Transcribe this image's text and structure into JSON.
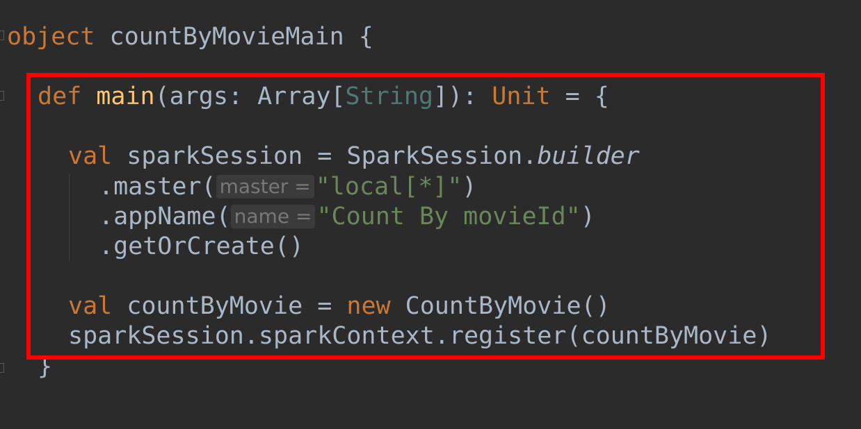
{
  "code": {
    "line1": {
      "kw": "object",
      "name": " countByMovieMain ",
      "brace": "{"
    },
    "line2": {
      "kw": "def",
      "fn": "main",
      "p1": "(args: ",
      "type": "Array",
      "lb": "[",
      "tparam": "String",
      "rb": "]",
      "p2": "): ",
      "ret": "Unit",
      "p3": " = {"
    },
    "line3": {
      "kw": "val",
      "rest": " sparkSession = SparkSession.",
      "builder": "builder"
    },
    "line4": {
      "call": ".master(",
      "hint": "master =",
      "str": "\"local[*]\"",
      "close": ")"
    },
    "line5": {
      "call": ".appName(",
      "hint": "name =",
      "str": "\"Count By movieId\"",
      "close": ")"
    },
    "line6": {
      "call": ".getOrCreate()"
    },
    "line7": {
      "kw": "val",
      "mid": " countByMovie = ",
      "kw2": "new",
      "rest": " CountByMovie()"
    },
    "line8": {
      "text": "sparkSession.sparkContext.register(countByMovie)"
    },
    "line9": {
      "text": "}"
    }
  },
  "colors": {
    "background": "#2b2b2b",
    "keyword": "#cc7832",
    "function": "#ffc66d",
    "string": "#6a8759",
    "text": "#a9b7c6",
    "highlight_border": "#ff0000"
  }
}
